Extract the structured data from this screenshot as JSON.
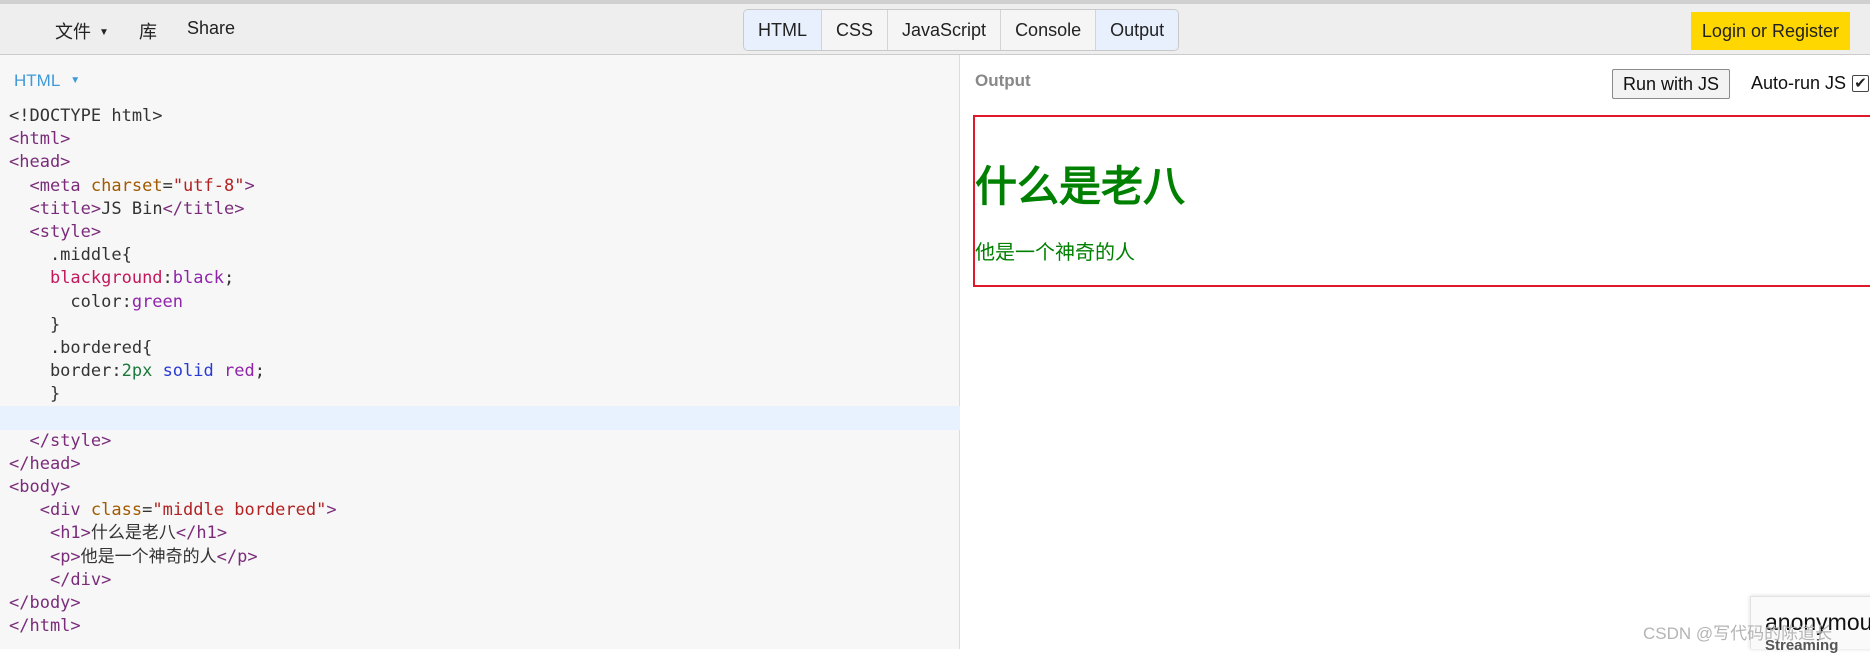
{
  "toolbar": {
    "menu": [
      {
        "label": "文件",
        "has_dropdown": true
      },
      {
        "label": "库"
      },
      {
        "label": "Share"
      }
    ],
    "panel_toggles": [
      {
        "label": "HTML",
        "active": true
      },
      {
        "label": "CSS",
        "active": false
      },
      {
        "label": "JavaScript",
        "active": false
      },
      {
        "label": "Console",
        "active": false
      },
      {
        "label": "Output",
        "active": true
      }
    ],
    "login_label": "Login or Register",
    "login_color": "#ffd700"
  },
  "editor": {
    "tab_label": "HTML",
    "caret_icon": "caret-down-icon",
    "active_line_index": 13,
    "code_lines": [
      [
        [
          "<!DOCTYPE html>",
          "plain"
        ]
      ],
      [
        [
          "<html>",
          "tag"
        ]
      ],
      [
        [
          "<head>",
          "tag"
        ]
      ],
      [
        [
          "  ",
          "plain"
        ],
        [
          "<meta ",
          "tag"
        ],
        [
          "charset",
          "attr"
        ],
        [
          "=",
          "plain"
        ],
        [
          "\"utf-8\"",
          "str"
        ],
        [
          ">",
          "tag"
        ]
      ],
      [
        [
          "  ",
          "plain"
        ],
        [
          "<title>",
          "tag"
        ],
        [
          "JS Bin",
          "plain"
        ],
        [
          "</title>",
          "tag"
        ]
      ],
      [
        [
          "  ",
          "plain"
        ],
        [
          "<style>",
          "tag"
        ]
      ],
      [
        [
          "    .middle{",
          "plain"
        ]
      ],
      [
        [
          "    ",
          "plain"
        ],
        [
          "blackground",
          "prop"
        ],
        [
          ":",
          "plain"
        ],
        [
          "black",
          "val"
        ],
        [
          ";",
          "plain"
        ]
      ],
      [
        [
          "      color:",
          "plain"
        ],
        [
          "green",
          "val"
        ]
      ],
      [
        [
          "    }",
          "plain"
        ]
      ],
      [
        [
          "    .bordered{",
          "plain"
        ]
      ],
      [
        [
          "    border:",
          "plain"
        ],
        [
          "2px",
          "num"
        ],
        [
          " ",
          "plain"
        ],
        [
          "solid",
          "kw"
        ],
        [
          " ",
          "plain"
        ],
        [
          "red",
          "val"
        ],
        [
          ";",
          "plain"
        ]
      ],
      [
        [
          "    }",
          "plain"
        ]
      ],
      [
        [
          "",
          "plain"
        ]
      ],
      [
        [
          "  ",
          "plain"
        ],
        [
          "</style>",
          "tag"
        ]
      ],
      [
        [
          "</head>",
          "tag"
        ]
      ],
      [
        [
          "<body>",
          "tag"
        ]
      ],
      [
        [
          "   ",
          "plain"
        ],
        [
          "<div ",
          "tag"
        ],
        [
          "class",
          "attr"
        ],
        [
          "=",
          "plain"
        ],
        [
          "\"middle bordered\"",
          "str"
        ],
        [
          ">",
          "tag"
        ]
      ],
      [
        [
          "    ",
          "plain"
        ],
        [
          "<h1>",
          "tag"
        ],
        [
          "什么是老八",
          "plain"
        ],
        [
          "</h1>",
          "tag"
        ]
      ],
      [
        [
          "    ",
          "plain"
        ],
        [
          "<p>",
          "tag"
        ],
        [
          "他是一个神奇的人",
          "plain"
        ],
        [
          "</p>",
          "tag"
        ]
      ],
      [
        [
          "    ",
          "plain"
        ],
        [
          "</div>",
          "tag"
        ]
      ],
      [
        [
          "</body>",
          "tag"
        ]
      ],
      [
        [
          "</html>",
          "tag"
        ]
      ]
    ]
  },
  "output": {
    "label": "Output",
    "run_label": "Run with JS",
    "autorun_label": "Auto-run JS",
    "autorun_checked": "✔",
    "heading": "什么是老八",
    "paragraph": "他是一个神奇的人",
    "text_color": "#008000",
    "border_color": "#e0182c"
  },
  "footer": {
    "user_name": "anonymous",
    "user_sub": "Streaming",
    "watermark": "CSDN @写代码的陈道长"
  }
}
